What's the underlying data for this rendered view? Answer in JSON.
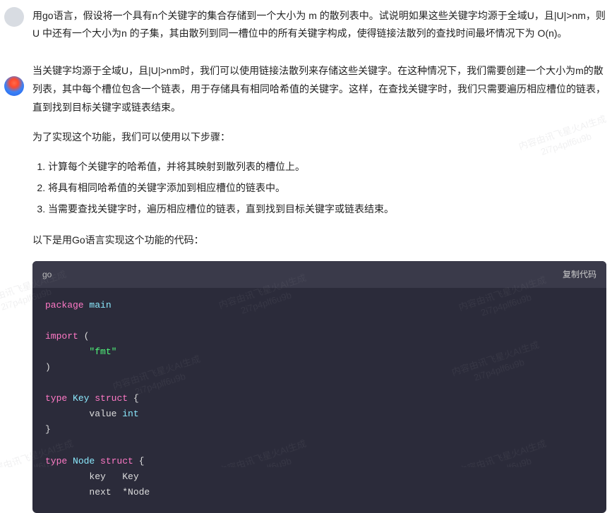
{
  "question": "用go语言，假设将一个具有n个关键字的集合存储到一个大小为 m 的散列表中。试说明如果这些关键字均源于全域U，且|U|>nm，则U 中还有一个大小为n 的子集，其由散列到同一槽位中的所有关键字构成，使得链接法散列的查找时间最坏情况下为 O(n)。",
  "answer": {
    "p1": "当关键字均源于全域U，且|U|>nm时，我们可以使用链接法散列来存储这些关键字。在这种情况下，我们需要创建一个大小为m的散列表，其中每个槽位包含一个链表，用于存储具有相同哈希值的关键字。这样，在查找关键字时，我们只需要遍历相应槽位的链表，直到找到目标关键字或链表结束。",
    "p2": "为了实现这个功能，我们可以使用以下步骤：",
    "steps": [
      "计算每个关键字的哈希值，并将其映射到散列表的槽位上。",
      "将具有相同哈希值的关键字添加到相应槽位的链表中。",
      "当需要查找关键字时，遍历相应槽位的链表，直到找到目标关键字或链表结束。"
    ],
    "p3": "以下是用Go语言实现这个功能的代码："
  },
  "code": {
    "lang": "go",
    "copy_label": "复制代码",
    "lines": {
      "l1_kw": "package",
      "l1_pkg": " main",
      "l3_kw": "import",
      "l3_rest": " (",
      "l4_str": "\"fmt\"",
      "l5": ")",
      "l7_kw": "type",
      "l7_name": " Key ",
      "l7_struct": "struct",
      "l7_brace": " {",
      "l8_field": "value ",
      "l8_type": "int",
      "l9": "}",
      "l11_kw": "type",
      "l11_name": " Node ",
      "l11_struct": "struct",
      "l11_brace": " {",
      "l12": "key   Key",
      "l13": "next  *Node"
    }
  },
  "watermark": {
    "line1": "内容由讯飞星火AI生成",
    "line2": "2i7p4plf6u9b"
  }
}
